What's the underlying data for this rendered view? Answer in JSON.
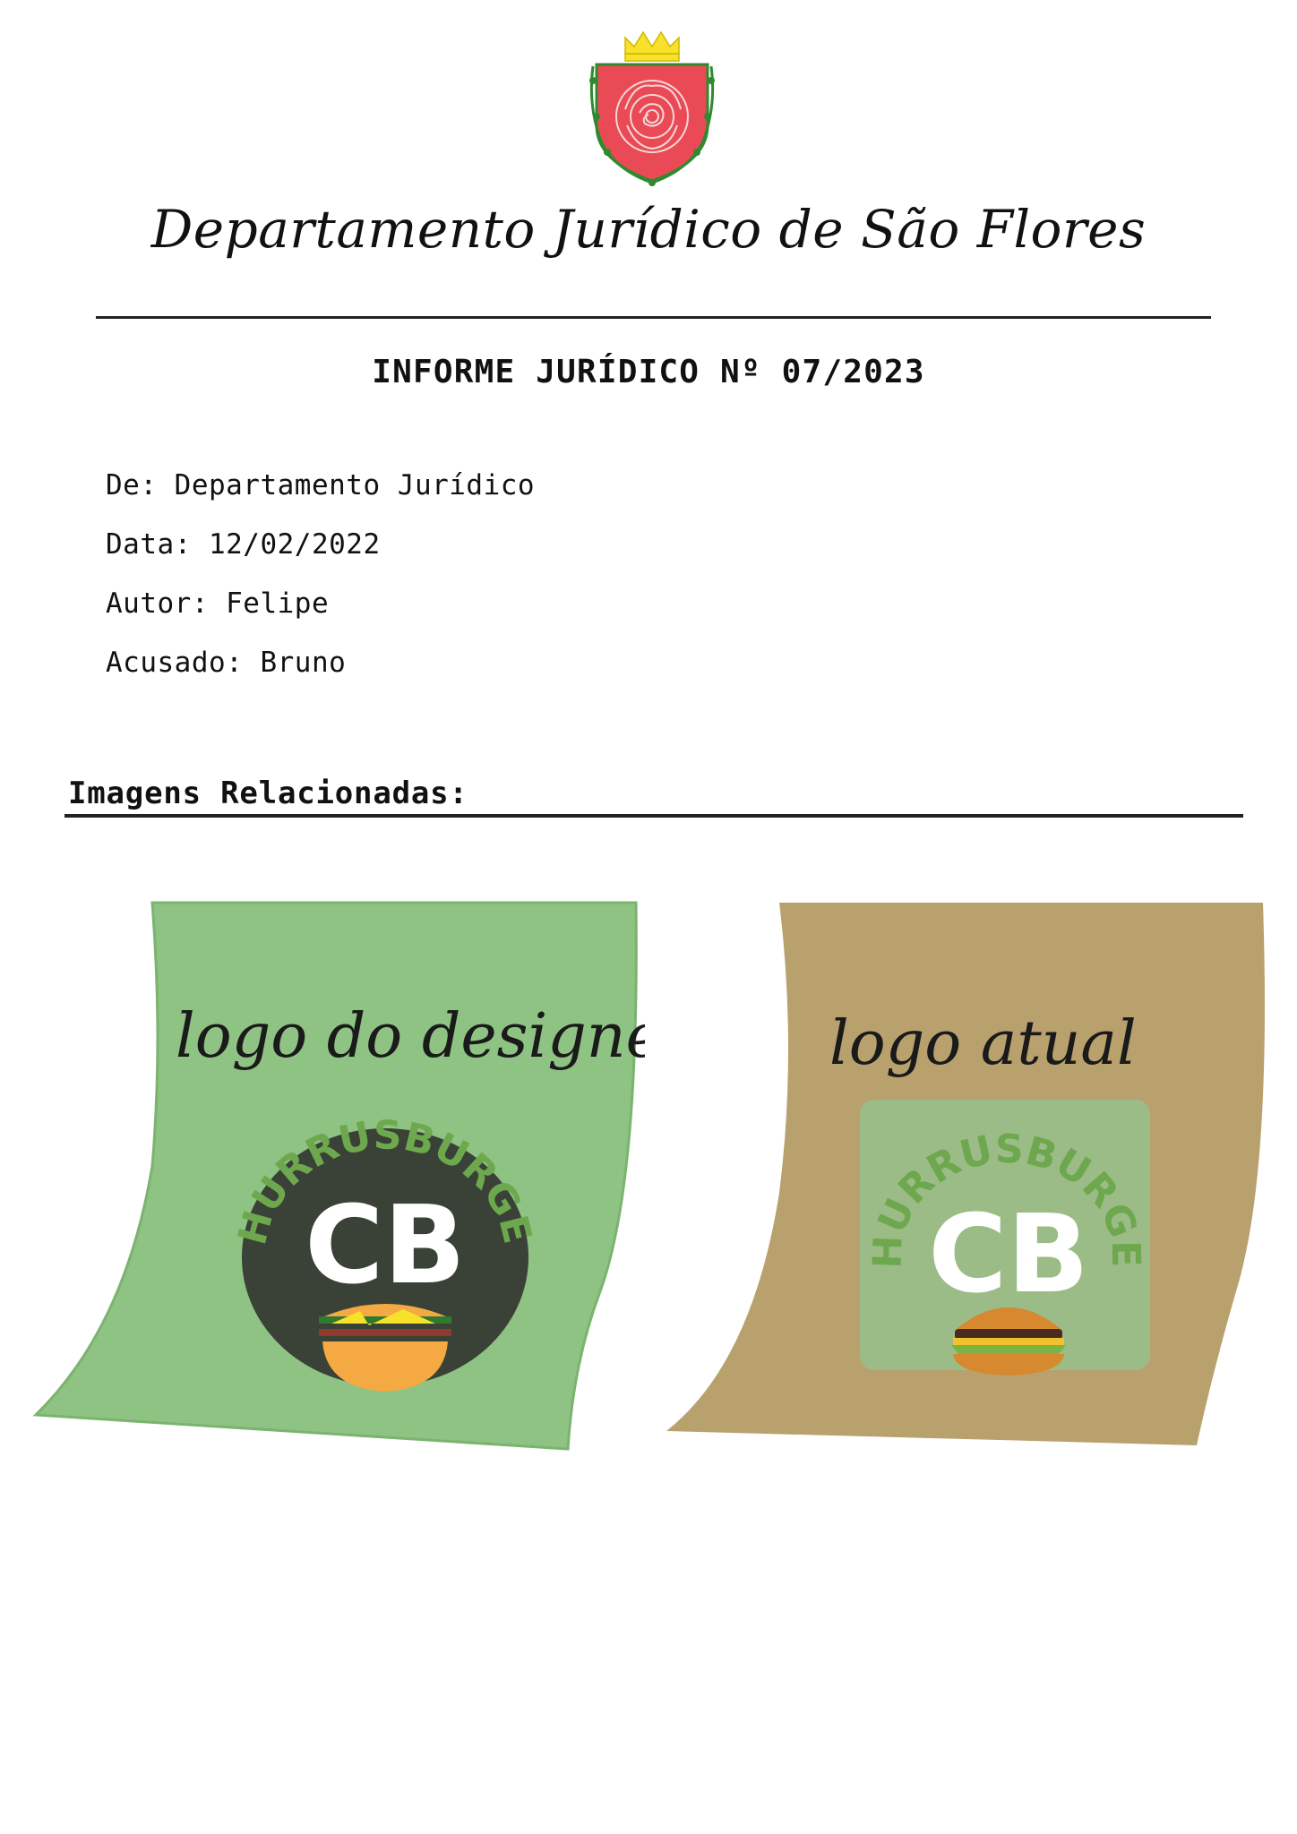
{
  "header": {
    "department_title": "Departamento Jurídico de São Flores",
    "crest_icon": "rose-crest-icon"
  },
  "document": {
    "title": "INFORME JURÍDICO Nº 07/2023",
    "meta": {
      "de": "De: Departamento Jurídico",
      "data": "Data: 12/02/2022",
      "autor": "Autor: Felipe",
      "acusado": "Acusado: Bruno"
    },
    "section_title": "Imagens Relacionadas:"
  },
  "images": [
    {
      "label": "logo do designer",
      "brand": "CHURRUSBURGER",
      "monogram": "CB",
      "sheet_color": "#8fc383",
      "badge_color": "#3a4136"
    },
    {
      "label": "logo atual",
      "brand": "CHURRUSBURGER",
      "monogram": "CB",
      "sheet_color": "#b9a16e",
      "badge_color": "#9bbc87"
    }
  ],
  "colors": {
    "crest_red": "#ea4a55",
    "crown_yellow": "#f7e12a",
    "brand_green": "#6ea84e",
    "rule": "#222222"
  }
}
